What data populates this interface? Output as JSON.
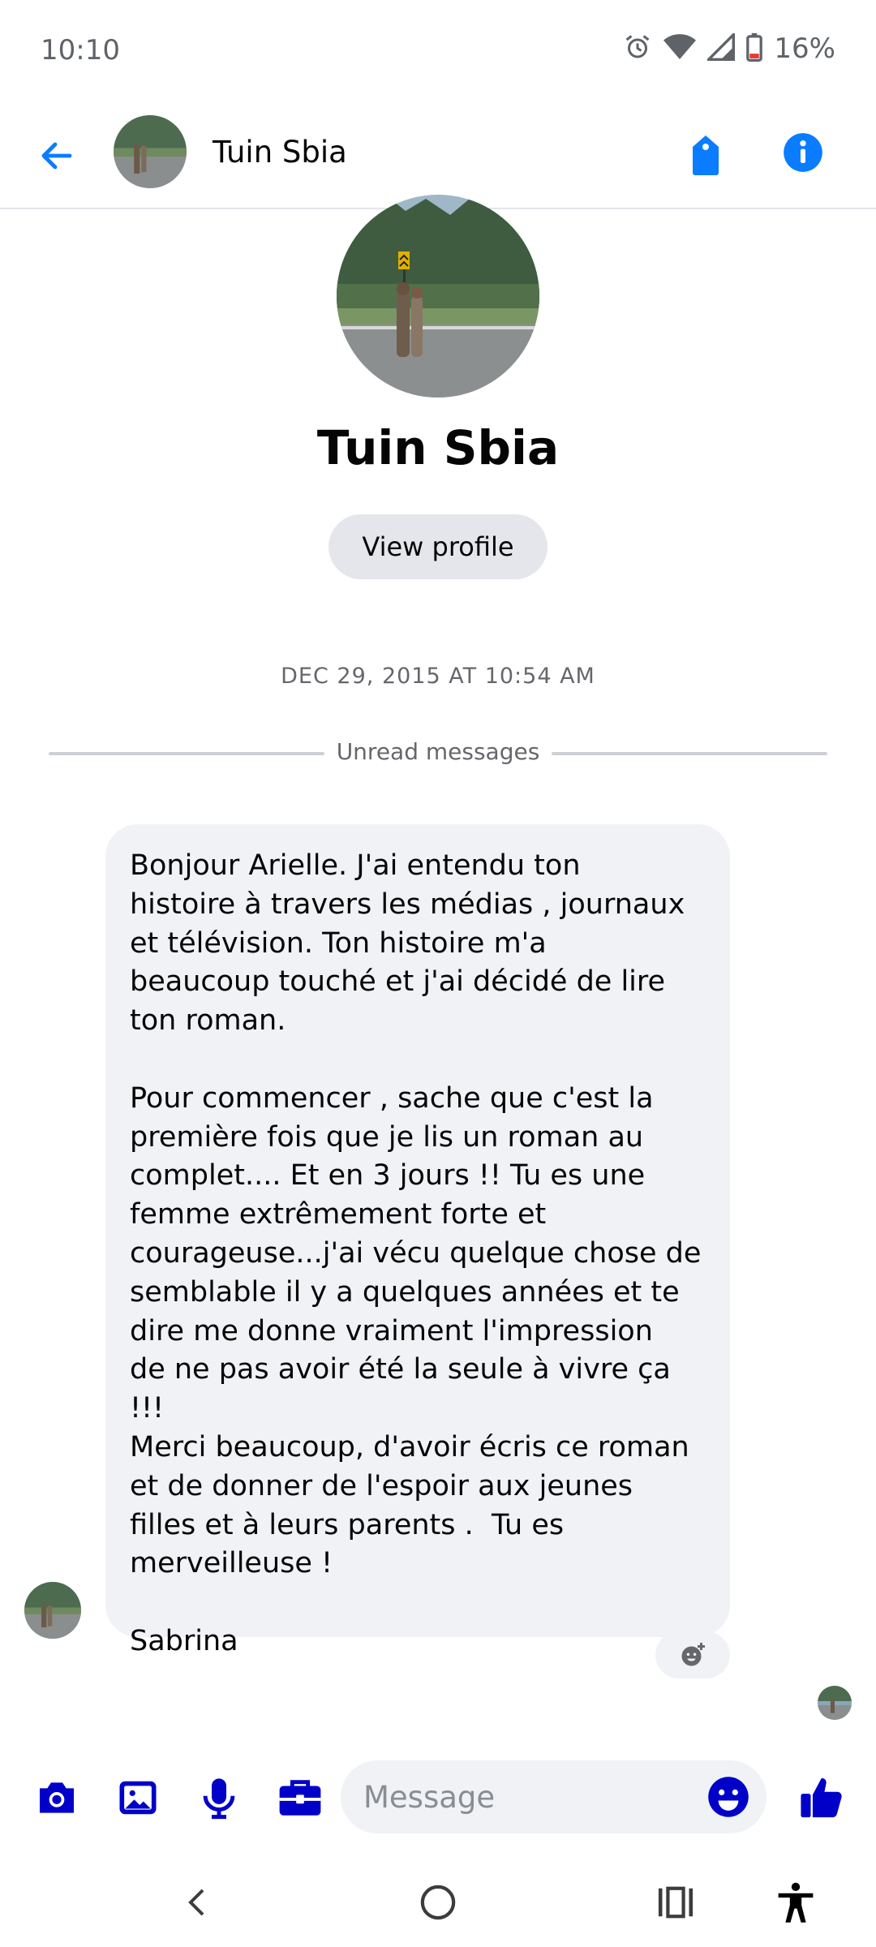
{
  "status_bar": {
    "time": "10:10",
    "battery_percent": "16%"
  },
  "header": {
    "contact_name": "Tuin Sbia"
  },
  "profile": {
    "name": "Tuin Sbia",
    "view_profile_label": "View profile"
  },
  "conversation": {
    "timestamp": "DEC 29, 2015 AT 10:54 AM",
    "unread_label": "Unread messages",
    "messages": [
      {
        "text": "Bonjour Arielle. J'ai entendu ton\nhistoire à travers les médias , journaux\net télévision. Ton histoire m'a\nbeaucoup touché et j'ai décidé de lire\nton roman.\n\nPour commencer , sache que c'est la\npremière fois que je lis un roman au\ncomplet.... Et en 3 jours !! Tu es une\nfemme extrêmement forte et\ncourageuse...j'ai vécu quelque chose de\nsemblable il y a quelques années et te\ndire me donne vraiment l'impression\nde ne pas avoir été la seule à vivre ça !!!\nMerci beaucoup, d'avoir écris ce roman\net de donner de l'espoir aux jeunes\nfilles et à leurs parents .  Tu es\nmerveilleuse !\n\nSabrina"
      }
    ]
  },
  "composer": {
    "placeholder": "Message"
  },
  "colors": {
    "accent": "#0a7cff",
    "composer_icons": "#0000c8",
    "bubble": "#f0f2f5"
  },
  "icons": [
    "back-arrow-icon",
    "tag-icon",
    "info-icon",
    "camera-icon",
    "image-icon",
    "microphone-icon",
    "briefcase-icon",
    "emoji-icon",
    "thumbs-up-icon",
    "add-reaction-icon",
    "nav-back-icon",
    "nav-home-icon",
    "nav-recents-icon",
    "accessibility-icon"
  ]
}
